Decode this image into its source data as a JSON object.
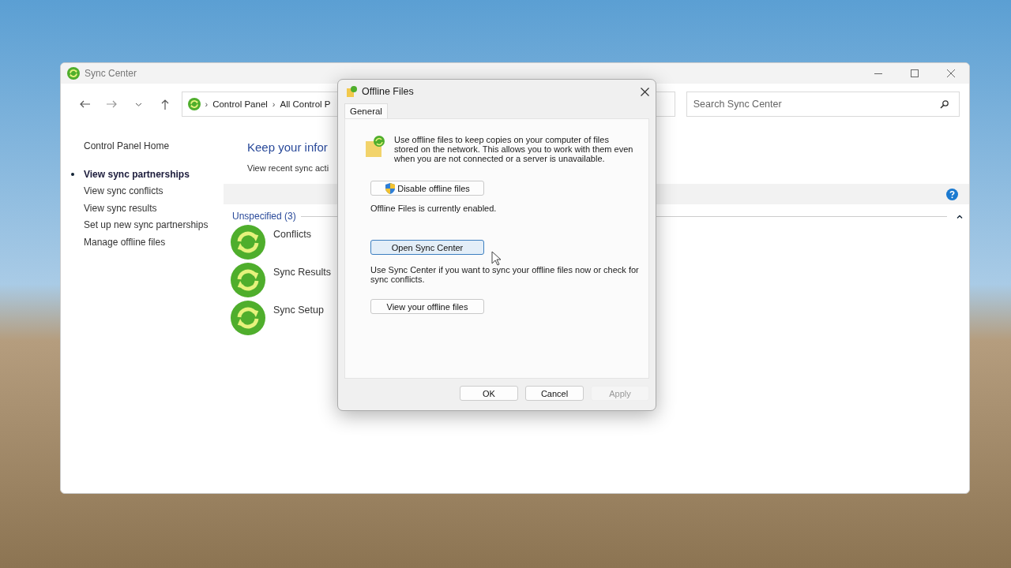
{
  "main_window": {
    "title": "Sync Center",
    "address": [
      {
        "separator": "›",
        "label": "Control Panel"
      },
      {
        "separator": "›",
        "label": "All Control P"
      }
    ],
    "search": {
      "placeholder": "Search Sync Center"
    },
    "sidebar": {
      "home": "Control Panel Home",
      "items": [
        {
          "label": "View sync partnerships",
          "selected": true
        },
        {
          "label": "View sync conflicts",
          "selected": false
        },
        {
          "label": "View sync results",
          "selected": false
        },
        {
          "label": "Set up new sync partnerships",
          "selected": false
        },
        {
          "label": "Manage offline files",
          "selected": false
        }
      ]
    },
    "heading": "Keep your infor",
    "subtext": "View recent sync acti",
    "group": {
      "label": "Unspecified (3)",
      "items": [
        "Conflicts",
        "Sync Results",
        "Sync Setup"
      ]
    }
  },
  "dialog": {
    "title": "Offline Files",
    "tabs": [
      {
        "label": "General",
        "selected": true
      }
    ],
    "description": "Use offline files to keep copies on your computer of files stored on the network.  This allows you to work with them even when you are not connected or a server is unavailable.",
    "disable_button": "Disable offline files",
    "status": "Offline Files is currently enabled.",
    "open_button": {
      "label": "Open Sync Center",
      "focused": true
    },
    "open_hint": "Use Sync Center if you want to sync your offline files now or check for sync conflicts.",
    "view_button": "View your offline files",
    "buttons": [
      {
        "label": "OK",
        "disabled": false
      },
      {
        "label": "Cancel",
        "disabled": false
      },
      {
        "label": "Apply",
        "disabled": true
      }
    ]
  }
}
